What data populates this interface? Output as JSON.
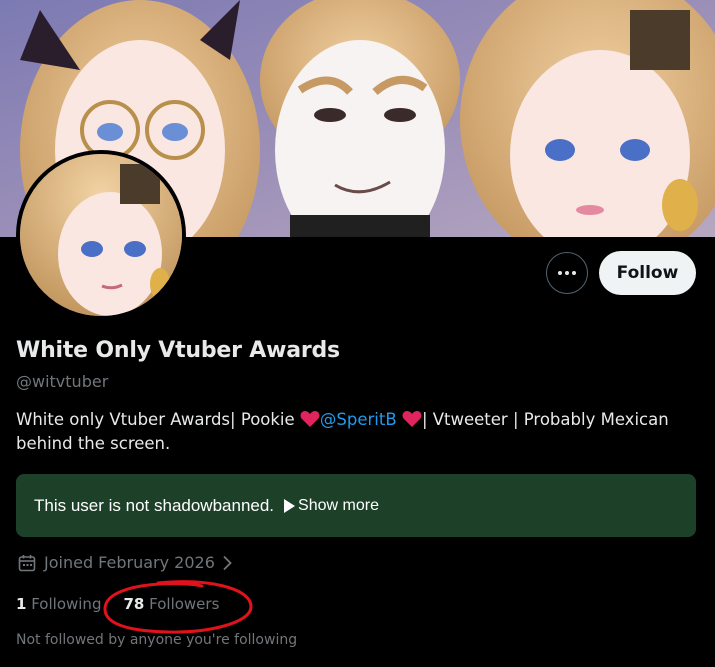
{
  "profile": {
    "display_name": "White Only Vtuber Awards",
    "handle": "@witvtuber",
    "bio_part1": "White only Vtuber Awards| Pookie ",
    "bio_mention": "@SperitB",
    "bio_part2": "| Vtweeter | Probably Mexican behind the screen.",
    "joined": "Joined February 2026",
    "following_count": "1",
    "following_label": "Following",
    "followers_count": "78",
    "followers_label": "Followers",
    "not_followed": "Not followed by anyone you're following"
  },
  "actions": {
    "follow_label": "Follow"
  },
  "notice": {
    "text": "This user is not shadowbanned.",
    "show_more": "Show more"
  },
  "icons": {
    "more": "more-dots-icon",
    "calendar": "calendar-icon",
    "chevron": "chevron-right-icon",
    "heart": "heart-icon"
  },
  "colors": {
    "background": "#000000",
    "accent": "#1d9bf0",
    "notice_bg": "#1d4029",
    "heart": "#e0245e",
    "annotation": "#e0121b"
  }
}
